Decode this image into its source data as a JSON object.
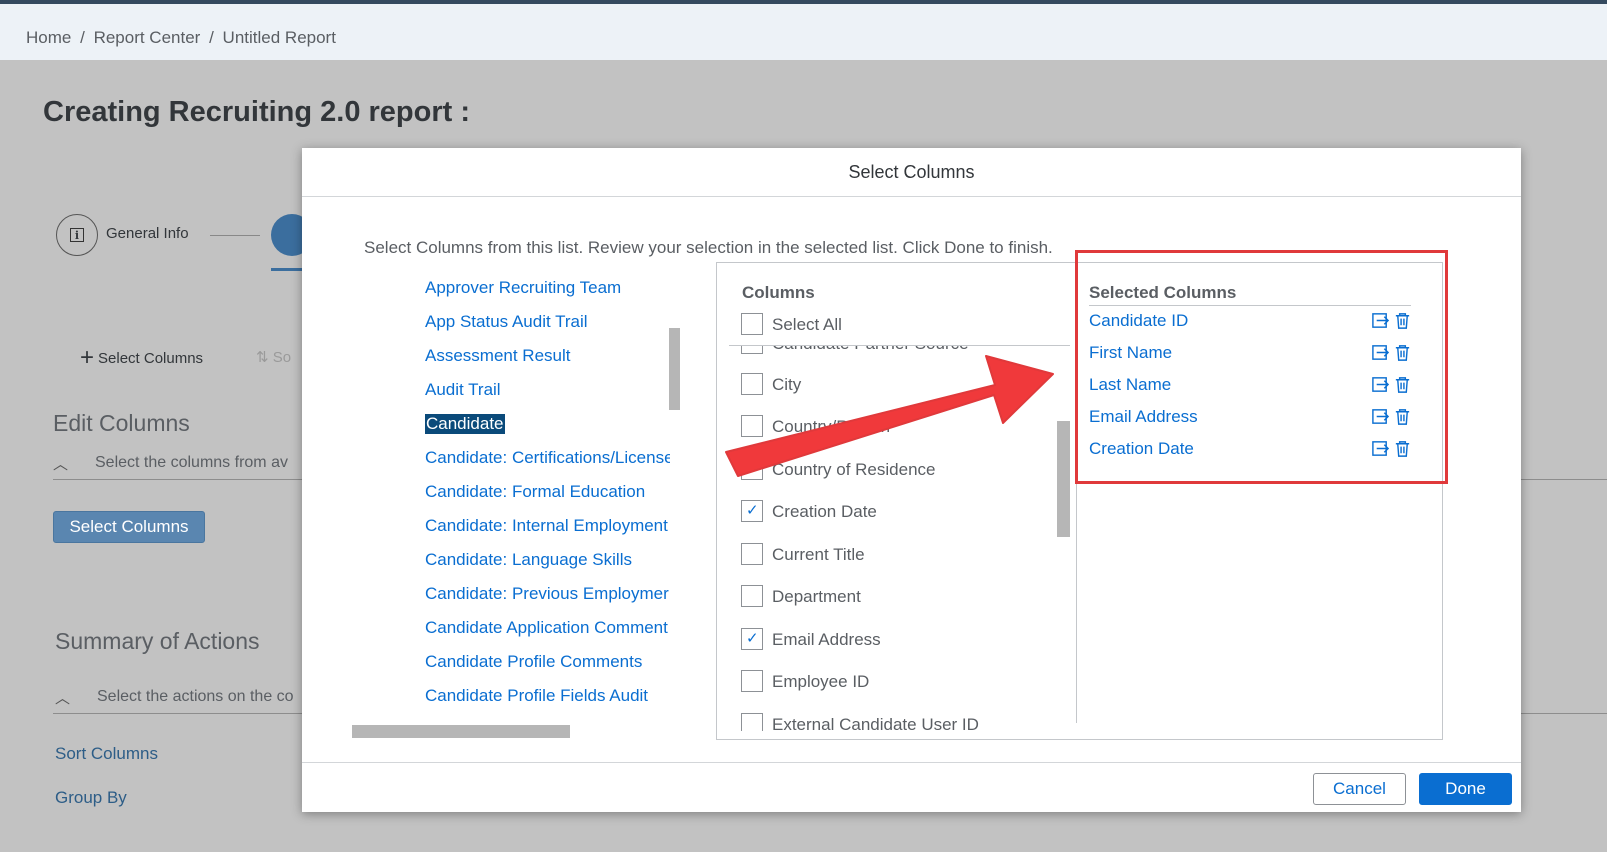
{
  "breadcrumb": {
    "home": "Home",
    "sep1": "/",
    "report_center": "Report Center",
    "sep2": "/",
    "current": "Untitled Report"
  },
  "page": {
    "title": "Creating Recruiting 2.0 report :",
    "steps": {
      "general_info": "General Info"
    },
    "toolbar": {
      "select_columns": "Select Columns",
      "sort": "So"
    },
    "edit_columns": {
      "heading": "Edit Columns",
      "subtext": "Select the columns from av",
      "button": "Select Columns"
    },
    "summary": {
      "heading": "Summary of Actions",
      "subtext": "Select the actions on the co"
    },
    "links": {
      "sort_columns": "Sort Columns",
      "group_by": "Group By"
    }
  },
  "modal": {
    "title": "Select Columns",
    "description": "Select Columns from this list. Review your selection in the selected list. Click Done to finish.",
    "categories": [
      "Approver Recruiting Team",
      "App Status Audit Trail",
      "Assessment Result",
      "Audit Trail",
      "Candidate",
      "Candidate: Certifications/License",
      "Candidate: Formal Education",
      "Candidate: Internal Employment",
      "Candidate: Language Skills",
      "Candidate: Previous Employmer",
      "Candidate Application Comment",
      "Candidate Profile Comments",
      "Candidate Profile Fields Audit"
    ],
    "selected_category": "Candidate",
    "columns": {
      "heading": "Columns",
      "select_all": "Select All",
      "partial_top": "Candidate Partner Source",
      "items": [
        {
          "label": "City",
          "checked": false
        },
        {
          "label": "Country/Region",
          "checked": false
        },
        {
          "label": "Country of Residence",
          "checked": false
        },
        {
          "label": "Creation Date",
          "checked": true
        },
        {
          "label": "Current Title",
          "checked": false
        },
        {
          "label": "Department",
          "checked": false
        },
        {
          "label": "Email Address",
          "checked": true
        },
        {
          "label": "Employee ID",
          "checked": false
        },
        {
          "label": "External Candidate User ID",
          "checked": false
        }
      ]
    },
    "selected": {
      "heading": "Selected Columns",
      "items": [
        "Candidate ID",
        "First Name",
        "Last Name",
        "Email Address",
        "Creation Date"
      ]
    },
    "footer": {
      "cancel": "Cancel",
      "done": "Done"
    }
  },
  "colors": {
    "accent": "#0a6ed1",
    "highlight": "#e0393b",
    "arrow": "#f0393b"
  },
  "icons": [
    "info-icon",
    "table-icon",
    "plus-icon",
    "sort-icon",
    "chevron-up-icon",
    "checkmark-icon",
    "move-icon",
    "trash-icon"
  ]
}
